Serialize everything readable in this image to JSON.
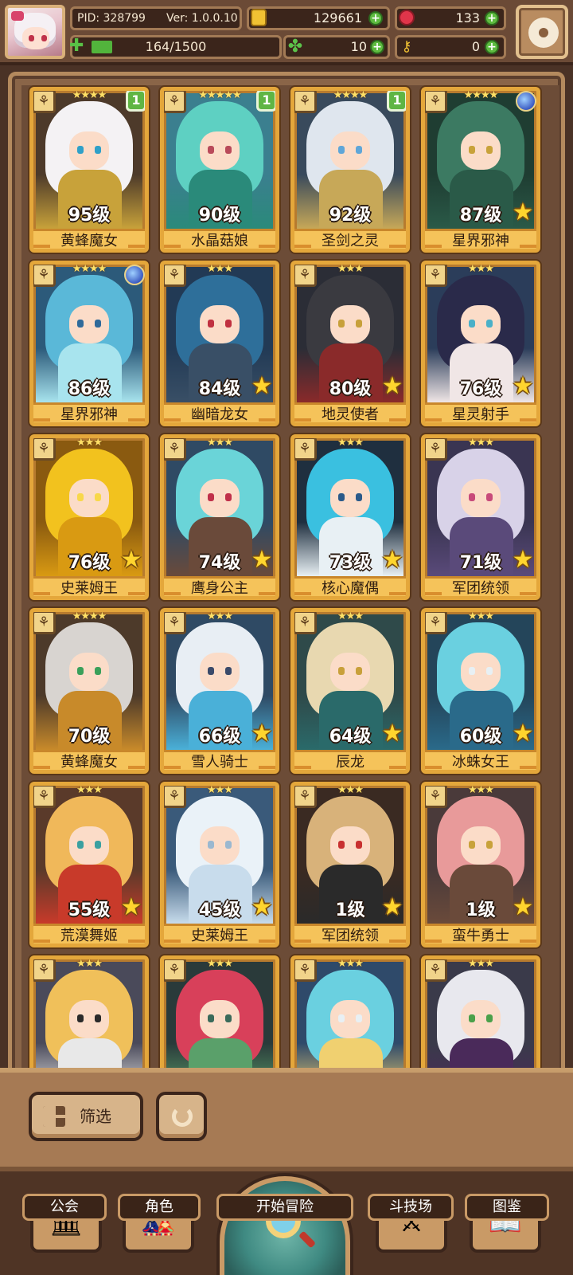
{
  "hud": {
    "pid": "PID: 328799",
    "version": "Ver: 1.0.0.10",
    "gold": "129661",
    "gems": "133",
    "xp": "164/1500",
    "xp_fraction": 0.109,
    "clovers": "10",
    "keys": "0",
    "icons": [
      "avatar",
      "gold-coin-icon",
      "red-gem-icon",
      "clover-icon",
      "key-icon",
      "gear-icon"
    ]
  },
  "cards": [
    {
      "level": "95级",
      "name": "黄蜂魔女",
      "stars": "★★★★",
      "badge": "1",
      "palette": [
        "#4d3a2a",
        "#f4f2f4",
        "#c8a23a",
        "#2fa0c8"
      ],
      "star_icon": false,
      "arrow": false,
      "orb": false
    },
    {
      "level": "90级",
      "name": "水晶菇娘",
      "stars": "★★★★★",
      "badge": "1",
      "palette": [
        "#3b7f8f",
        "#5ed0c2",
        "#2a8a7a",
        "#b94a5a"
      ],
      "star_icon": false,
      "arrow": false,
      "orb": false
    },
    {
      "level": "92级",
      "name": "圣剑之灵",
      "stars": "★★★★",
      "badge": "1",
      "palette": [
        "#394a5c",
        "#dfe6ee",
        "#c7a858",
        "#5fa6d8"
      ],
      "star_icon": false,
      "arrow": false,
      "orb": false
    },
    {
      "level": "87级",
      "name": "星界邪神",
      "stars": "★★★★",
      "badge": "",
      "palette": [
        "#1f3d32",
        "#3c7a62",
        "#2a5a48",
        "#c8a23a"
      ],
      "star_icon": true,
      "arrow": false,
      "orb": true
    },
    {
      "level": "86级",
      "name": "星界邪神",
      "stars": "★★★★",
      "badge": "",
      "palette": [
        "#2c5a7a",
        "#5ab8d8",
        "#a8e4ee",
        "#2f6a9a"
      ],
      "star_icon": false,
      "arrow": false,
      "orb": true
    },
    {
      "level": "84级",
      "name": "幽暗龙女",
      "stars": "★★★",
      "badge": "",
      "palette": [
        "#223a55",
        "#2e6f9a",
        "#394f66",
        "#c03040"
      ],
      "star_icon": true,
      "arrow": false,
      "orb": false
    },
    {
      "level": "80级",
      "name": "地灵使者",
      "stars": "★★★",
      "badge": "",
      "palette": [
        "#2b2d36",
        "#3a3a40",
        "#8a2a2a",
        "#c7a03a"
      ],
      "star_icon": true,
      "arrow": true,
      "orb": false
    },
    {
      "level": "76级",
      "name": "星灵射手",
      "stars": "★★★",
      "badge": "",
      "palette": [
        "#2b3d5a",
        "#2a2a4a",
        "#f0e6e6",
        "#4ab0c8"
      ],
      "star_icon": true,
      "arrow": true,
      "orb": false
    },
    {
      "level": "76级",
      "name": "史莱姆王",
      "stars": "★★★",
      "badge": "",
      "palette": [
        "#8a5a10",
        "#f2c21e",
        "#d99a12",
        "#f8d84a"
      ],
      "star_icon": true,
      "arrow": true,
      "orb": false
    },
    {
      "level": "74级",
      "name": "鹰身公主",
      "stars": "★★★",
      "badge": "",
      "palette": [
        "#2f4a64",
        "#6ad4d8",
        "#6a4a3a",
        "#c0304a"
      ],
      "star_icon": true,
      "arrow": true,
      "orb": false
    },
    {
      "level": "73级",
      "name": "核心魔偶",
      "stars": "★★★",
      "badge": "",
      "palette": [
        "#1f2f3f",
        "#3ac0e0",
        "#e8f0f4",
        "#2a5a8a"
      ],
      "star_icon": true,
      "arrow": true,
      "orb": false
    },
    {
      "level": "71级",
      "name": "军团统领",
      "stars": "★★★",
      "badge": "",
      "palette": [
        "#3a3552",
        "#d8d2e8",
        "#5a4a7a",
        "#c84a7a"
      ],
      "star_icon": true,
      "arrow": true,
      "orb": false
    },
    {
      "level": "70级",
      "name": "黄蜂魔女",
      "stars": "★★★★",
      "badge": "",
      "palette": [
        "#4d3a2a",
        "#d8d4d0",
        "#c88a2a",
        "#3aa05a"
      ],
      "star_icon": false,
      "arrow": true,
      "orb": false
    },
    {
      "level": "66级",
      "name": "雪人骑士",
      "stars": "★★★",
      "badge": "",
      "palette": [
        "#2f4a64",
        "#e8eef4",
        "#4ab0d8",
        "#3a4a6a"
      ],
      "star_icon": true,
      "arrow": true,
      "orb": false
    },
    {
      "level": "64级",
      "name": "辰龙",
      "stars": "★★★",
      "badge": "",
      "palette": [
        "#2f4a4a",
        "#e8d8b0",
        "#2a6a6a",
        "#c8a03a"
      ],
      "star_icon": true,
      "arrow": true,
      "orb": false
    },
    {
      "level": "60级",
      "name": "冰蛛女王",
      "stars": "★★★",
      "badge": "",
      "palette": [
        "#24455a",
        "#6ad0e0",
        "#2a6a8a",
        "#e8f0f4"
      ],
      "star_icon": true,
      "arrow": true,
      "orb": false
    },
    {
      "level": "55级",
      "name": "荒漠舞姬",
      "stars": "★★★",
      "badge": "",
      "palette": [
        "#5a3a2a",
        "#f0b85a",
        "#c83a2a",
        "#3aa0a0"
      ],
      "star_icon": true,
      "arrow": true,
      "orb": false
    },
    {
      "level": "45级",
      "name": "史莱姆王",
      "stars": "★★★",
      "badge": "",
      "palette": [
        "#3a5a7a",
        "#eaf2f8",
        "#c8dcec",
        "#9ab8d0"
      ],
      "star_icon": true,
      "arrow": true,
      "orb": false
    },
    {
      "level": "1级",
      "name": "军团统领",
      "stars": "★★★",
      "badge": "",
      "palette": [
        "#3a2a22",
        "#d8b27a",
        "#2a2a2a",
        "#c83030"
      ],
      "star_icon": true,
      "arrow": true,
      "orb": false
    },
    {
      "level": "1级",
      "name": "蛮牛勇士",
      "stars": "★★★",
      "badge": "",
      "palette": [
        "#4a3a3a",
        "#e89a9a",
        "#6a4a3a",
        "#c8a23a"
      ],
      "star_icon": true,
      "arrow": true,
      "orb": false
    },
    {
      "level": "",
      "name": "",
      "stars": "★★★",
      "badge": "",
      "palette": [
        "#4a4a5a",
        "#f0c05a",
        "#e8e8e8",
        "#2a2a2a"
      ],
      "star_icon": false,
      "arrow": false,
      "orb": false
    },
    {
      "level": "",
      "name": "",
      "stars": "★★★",
      "badge": "",
      "palette": [
        "#2a3a3a",
        "#d8405a",
        "#5aa06a",
        "#3a6a5a"
      ],
      "star_icon": false,
      "arrow": false,
      "orb": false
    },
    {
      "level": "",
      "name": "",
      "stars": "★★★",
      "badge": "",
      "palette": [
        "#2f4a6a",
        "#6ad0e0",
        "#f0d070",
        "#e8f0f4"
      ],
      "star_icon": false,
      "arrow": false,
      "orb": false
    },
    {
      "level": "",
      "name": "",
      "stars": "★★★",
      "badge": "",
      "palette": [
        "#3a3a4a",
        "#e8e8ee",
        "#4a2a5a",
        "#4aa04a"
      ],
      "star_icon": false,
      "arrow": false,
      "orb": false
    }
  ],
  "filter": {
    "filter_label": "筛选"
  },
  "nav": {
    "guild": "公会",
    "characters": "角色",
    "adventure": "开始冒险",
    "arena": "斗技场",
    "codex": "图鉴"
  }
}
